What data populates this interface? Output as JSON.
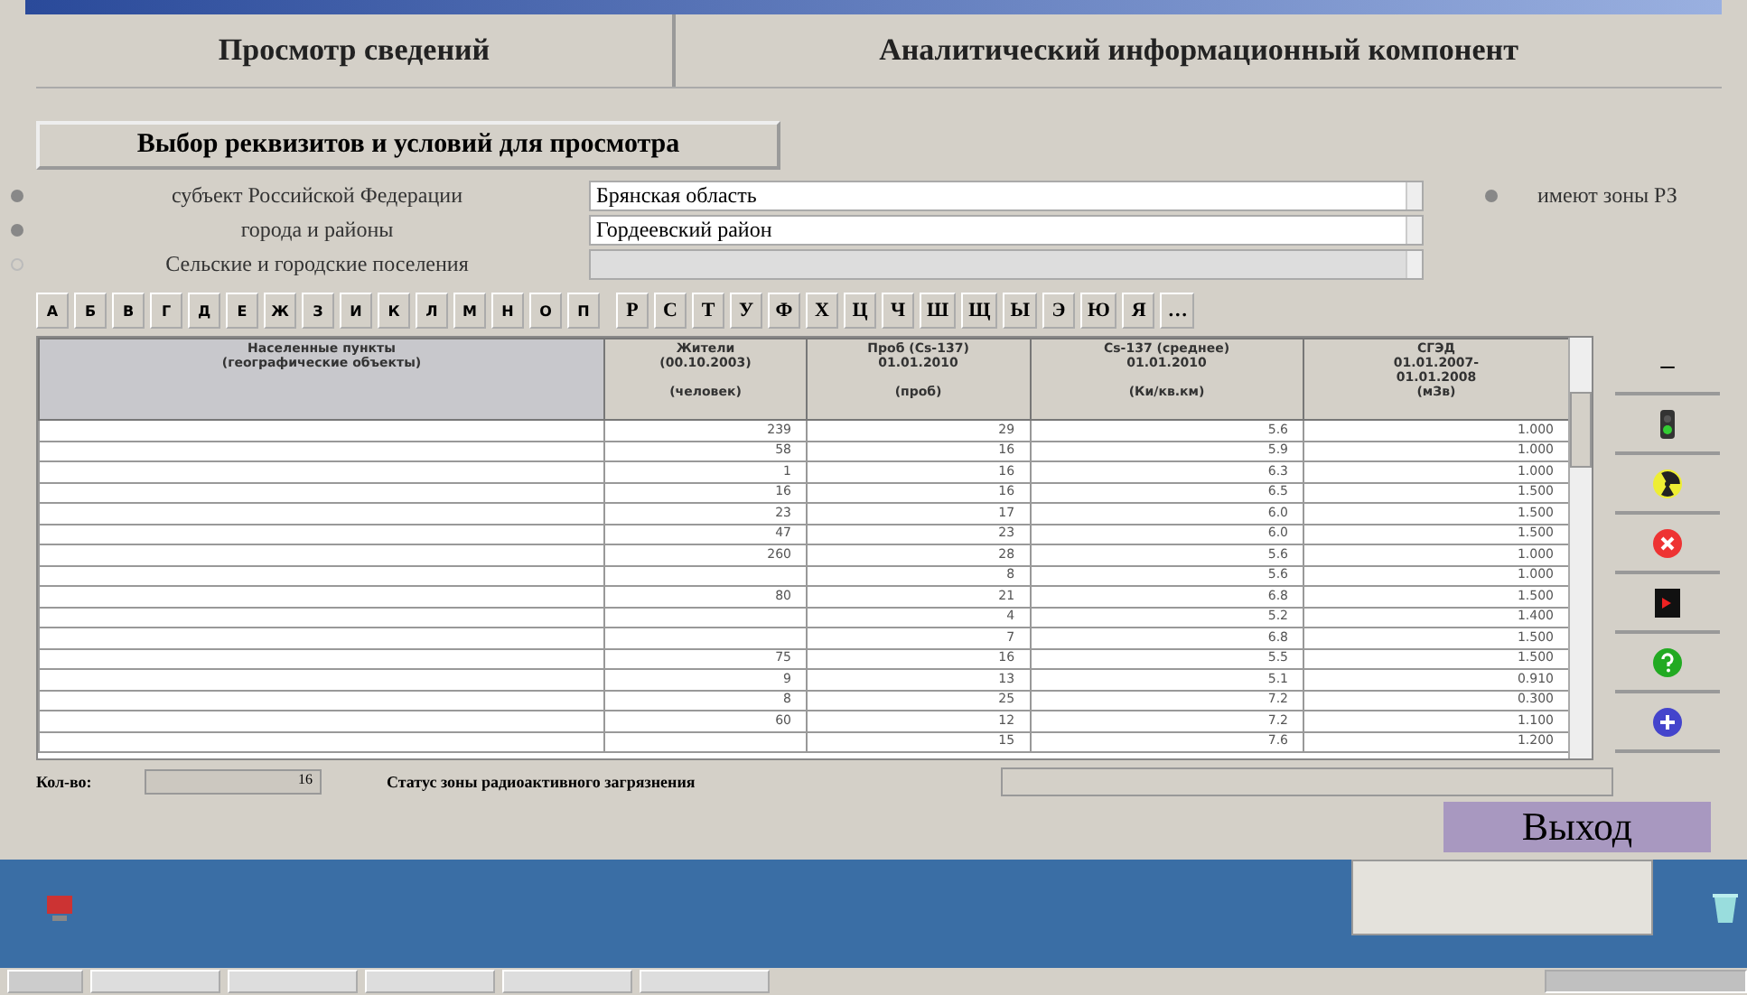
{
  "tabs": [
    {
      "label": "Просмотр  сведений"
    },
    {
      "label": "Аналитический информационный компонент"
    }
  ],
  "select_button": "Выбор реквизитов  и условий для просмотра",
  "filters": [
    {
      "label": "субъект Российской Федерации",
      "selected": true,
      "value": "Брянская область"
    },
    {
      "label": "города и районы",
      "selected": true,
      "value": "Гордеевский район"
    },
    {
      "label": "Сельские и городские поселения",
      "selected": false
    }
  ],
  "zone_option": {
    "label": "имеют зоны РЗ",
    "selected": true
  },
  "letters": [
    "А",
    "Б",
    "В",
    "Г",
    "Д",
    "Е",
    "Ж",
    "З",
    "И",
    "К",
    "Л",
    "М",
    "Н",
    "О",
    "П",
    "Р",
    "С",
    "Т",
    "У",
    "Ф",
    "Х",
    "Ц",
    "Ч",
    "Ш",
    "Щ",
    "Ы",
    "Э",
    "Ю",
    "Я",
    "…"
  ],
  "table": {
    "columns": [
      "Населенные пункты\n(географические объекты)",
      "Жители\n(00.10.2003)\n\n(человек)",
      "Проб (Cs-137)\n01.01.2010\n\n(проб)",
      "Cs-137 (среднее)\n01.01.2010\n\n(Ки/кв.км)",
      "СГЭД\n01.01.2007-\n01.01.2008\n(мЗв)"
    ],
    "rows": [
      {
        "cells": [
          "",
          "239",
          "29",
          "5.6",
          "1.000"
        ]
      },
      {
        "cells": [
          "",
          "58",
          "16",
          "5.9",
          "1.000"
        ]
      },
      {
        "cells": [
          "",
          "1",
          "16",
          "6.3",
          "1.000"
        ]
      },
      {
        "cells": [
          "",
          "16",
          "16",
          "6.5",
          "1.500"
        ]
      },
      {
        "cells": [
          "",
          "23",
          "17",
          "6.0",
          "1.500"
        ]
      },
      {
        "cells": [
          "",
          "47",
          "23",
          "6.0",
          "1.500"
        ]
      },
      {
        "cells": [
          "",
          "260",
          "28",
          "5.6",
          "1.000"
        ]
      },
      {
        "cells": [
          "",
          "",
          "8",
          "5.6",
          "1.000"
        ]
      },
      {
        "cells": [
          "",
          "80",
          "21",
          "6.8",
          "1.500"
        ]
      },
      {
        "cells": [
          "",
          "",
          "4",
          "5.2",
          "1.400"
        ]
      },
      {
        "cells": [
          "",
          "",
          "7",
          "6.8",
          "1.500"
        ]
      },
      {
        "cells": [
          "",
          "75",
          "16",
          "5.5",
          "1.500"
        ]
      },
      {
        "cells": [
          "",
          "9",
          "13",
          "5.1",
          "0.910"
        ]
      },
      {
        "cells": [
          "",
          "8",
          "25",
          "7.2",
          "0.300"
        ]
      },
      {
        "cells": [
          "",
          "60",
          "12",
          "7.2",
          "1.100"
        ]
      },
      {
        "cells": [
          "",
          "",
          "15",
          "7.6",
          "1.200"
        ]
      }
    ]
  },
  "side_buttons": [
    {
      "kind": "minus",
      "label": "–"
    },
    {
      "kind": "traffic"
    },
    {
      "kind": "radiation"
    },
    {
      "kind": "stop"
    },
    {
      "kind": "door"
    },
    {
      "kind": "help"
    },
    {
      "kind": "add"
    }
  ],
  "status": {
    "count_label": "Кол-во:",
    "count": "16",
    "zone_label": "Статус зоны радиоактивного загрязнения"
  },
  "exit_button": "Выход"
}
